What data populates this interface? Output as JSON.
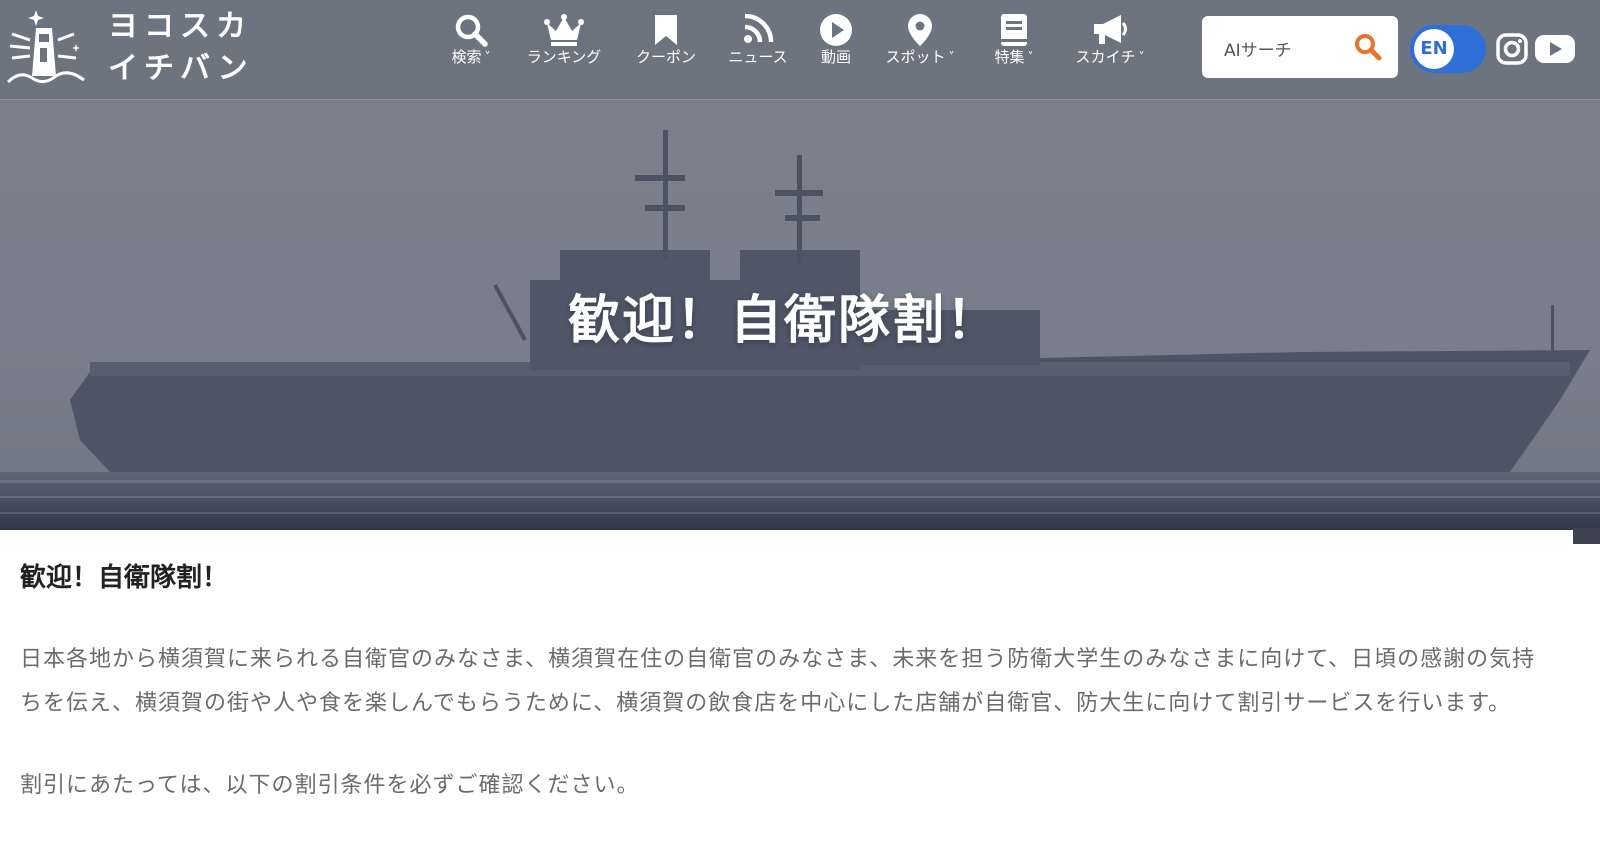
{
  "site": {
    "logo_line1": "ヨコスカ",
    "logo_line2": "イチバン"
  },
  "nav": [
    {
      "label": "検索",
      "icon": "search-icon",
      "dropdown": true
    },
    {
      "label": "ランキング",
      "icon": "crown-icon",
      "dropdown": false
    },
    {
      "label": "クーポン",
      "icon": "bookmark-icon",
      "dropdown": false
    },
    {
      "label": "ニュース",
      "icon": "rss-icon",
      "dropdown": false
    },
    {
      "label": "動画",
      "icon": "play-circle-icon",
      "dropdown": false
    },
    {
      "label": "スポット",
      "icon": "map-pin-icon",
      "dropdown": true
    },
    {
      "label": "特集",
      "icon": "book-icon",
      "dropdown": true
    },
    {
      "label": "スカイチ",
      "icon": "megaphone-icon",
      "dropdown": true
    }
  ],
  "search": {
    "placeholder": "AIサーチ"
  },
  "language": {
    "toggle_label": "EN"
  },
  "social": [
    "instagram-icon",
    "youtube-icon"
  ],
  "colors": {
    "header_bg": "#6c7480",
    "search_accent": "#e8742c",
    "lang_toggle": "#2f6fd8"
  },
  "hero": {
    "title": "歓迎！自衛隊割！"
  },
  "article": {
    "heading": "歓迎！自衛隊割！",
    "paragraph1": "日本各地から横須賀に来られる自衛官のみなさま、横須賀在住の自衛官のみなさま、未来を担う防衛大学生のみなさまに向けて、日頃の感謝の気持ちを伝え、横須賀の街や人や食を楽しんでもらうために、横須賀の飲食店を中心にした店舗が自衛官、防大生に向けて割引サービスを行います。",
    "paragraph2": "割引にあたっては、以下の割引条件を必ずご確認ください。"
  }
}
